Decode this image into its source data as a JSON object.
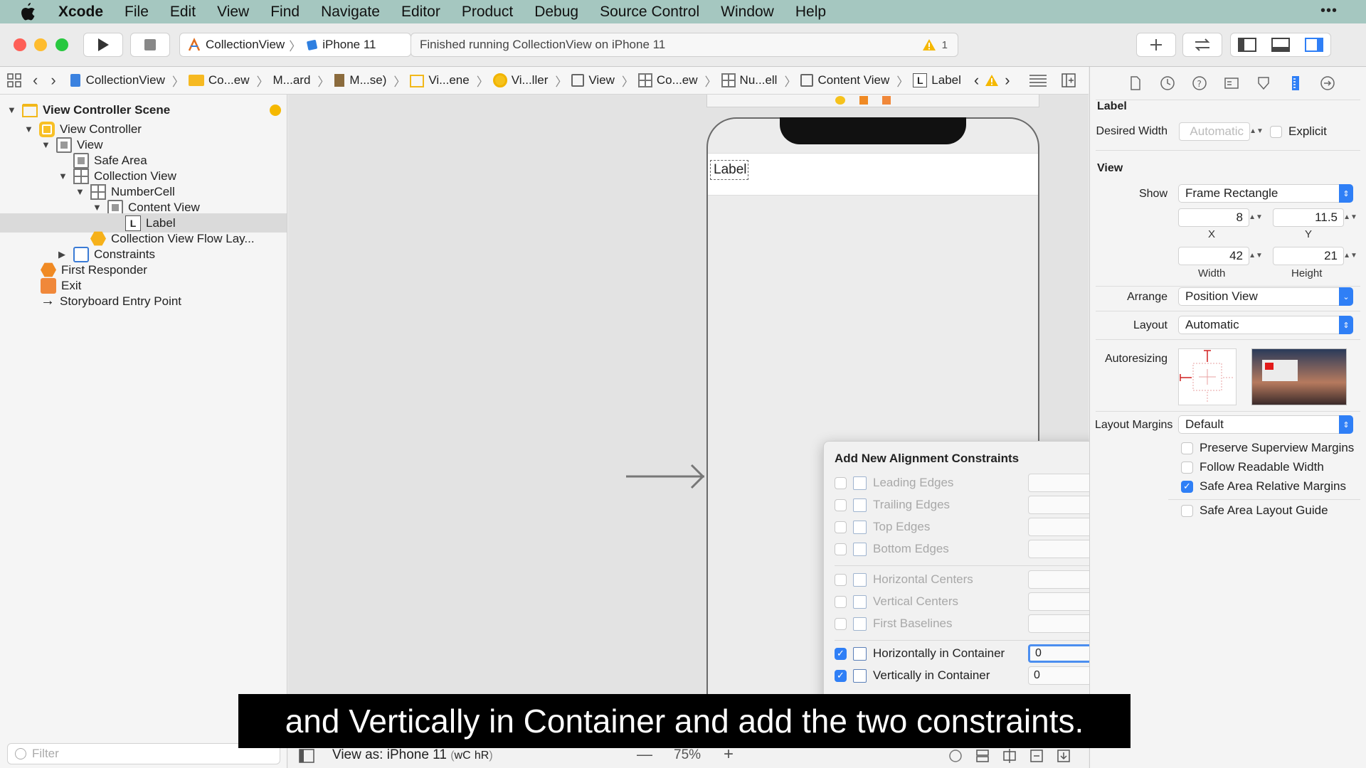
{
  "menubar": {
    "items": [
      "Xcode",
      "File",
      "Edit",
      "View",
      "Find",
      "Navigate",
      "Editor",
      "Product",
      "Debug",
      "Source Control",
      "Window",
      "Help"
    ]
  },
  "toolbar": {
    "scheme": "CollectionView",
    "device": "iPhone 11",
    "status": "Finished running CollectionView on iPhone 11",
    "warning_count": "1"
  },
  "jumpbar": {
    "items": [
      "CollectionView",
      "Co...ew",
      "M...ard",
      "M...se)",
      "Vi...ene",
      "Vi...ller",
      "View",
      "Co...ew",
      "Nu...ell",
      "Content View",
      "Label"
    ]
  },
  "navigator": {
    "rows": [
      {
        "label": "View Controller Scene"
      },
      {
        "label": "View Controller"
      },
      {
        "label": "View"
      },
      {
        "label": "Safe Area"
      },
      {
        "label": "Collection View"
      },
      {
        "label": "NumberCell"
      },
      {
        "label": "Content View"
      },
      {
        "label": "Label"
      },
      {
        "label": "Collection View Flow Lay..."
      },
      {
        "label": "Constraints"
      },
      {
        "label": "First Responder"
      },
      {
        "label": "Exit"
      },
      {
        "label": "Storyboard Entry Point"
      }
    ],
    "filter_placeholder": "Filter"
  },
  "canvas": {
    "label_text": "Label"
  },
  "popover": {
    "title": "Add New Alignment Constraints",
    "rows": [
      {
        "label": "Leading Edges",
        "checked": false,
        "enabled": false,
        "value": ""
      },
      {
        "label": "Trailing Edges",
        "checked": false,
        "enabled": false,
        "value": ""
      },
      {
        "label": "Top Edges",
        "checked": false,
        "enabled": false,
        "value": ""
      },
      {
        "label": "Bottom Edges",
        "checked": false,
        "enabled": false,
        "value": ""
      },
      {
        "label": "Horizontal Centers",
        "checked": false,
        "enabled": false,
        "value": ""
      },
      {
        "label": "Vertical Centers",
        "checked": false,
        "enabled": false,
        "value": ""
      },
      {
        "label": "First Baselines",
        "checked": false,
        "enabled": false,
        "value": ""
      },
      {
        "label": "Horizontally in Container",
        "checked": true,
        "enabled": true,
        "value": "0"
      },
      {
        "label": "Vertically in Container",
        "checked": true,
        "enabled": true,
        "value": "0"
      }
    ]
  },
  "inspector": {
    "label_section": "Label",
    "desired_width_label": "Desired Width",
    "desired_width_placeholder": "Automatic",
    "explicit_label": "Explicit",
    "view_section": "View",
    "show_label": "Show",
    "show_value": "Frame Rectangle",
    "x_value": "8",
    "y_value": "11.5",
    "x_label": "X",
    "y_label": "Y",
    "width_value": "42",
    "height_value": "21",
    "width_label": "Width",
    "height_label": "Height",
    "arrange_label": "Arrange",
    "arrange_value": "Position View",
    "layout_label": "Layout",
    "layout_value": "Automatic",
    "autoresizing_label": "Autoresizing",
    "layout_margins_label": "Layout Margins",
    "layout_margins_value": "Default",
    "checks": [
      {
        "label": "Preserve Superview Margins",
        "checked": false
      },
      {
        "label": "Follow Readable Width",
        "checked": false
      },
      {
        "label": "Safe Area Relative Margins",
        "checked": true
      },
      {
        "label": "Safe Area Layout Guide",
        "checked": false
      }
    ]
  },
  "bottombar": {
    "view_as": "View as: iPhone 11",
    "w_class": "wC",
    "h_class": "hR",
    "zoom": "75%"
  },
  "caption": "and Vertically in Container and add the two constraints.",
  "colors": {
    "menubar_bg": "#a5c7c0",
    "accent": "#2f7ff6",
    "warning": "#f5b800"
  }
}
